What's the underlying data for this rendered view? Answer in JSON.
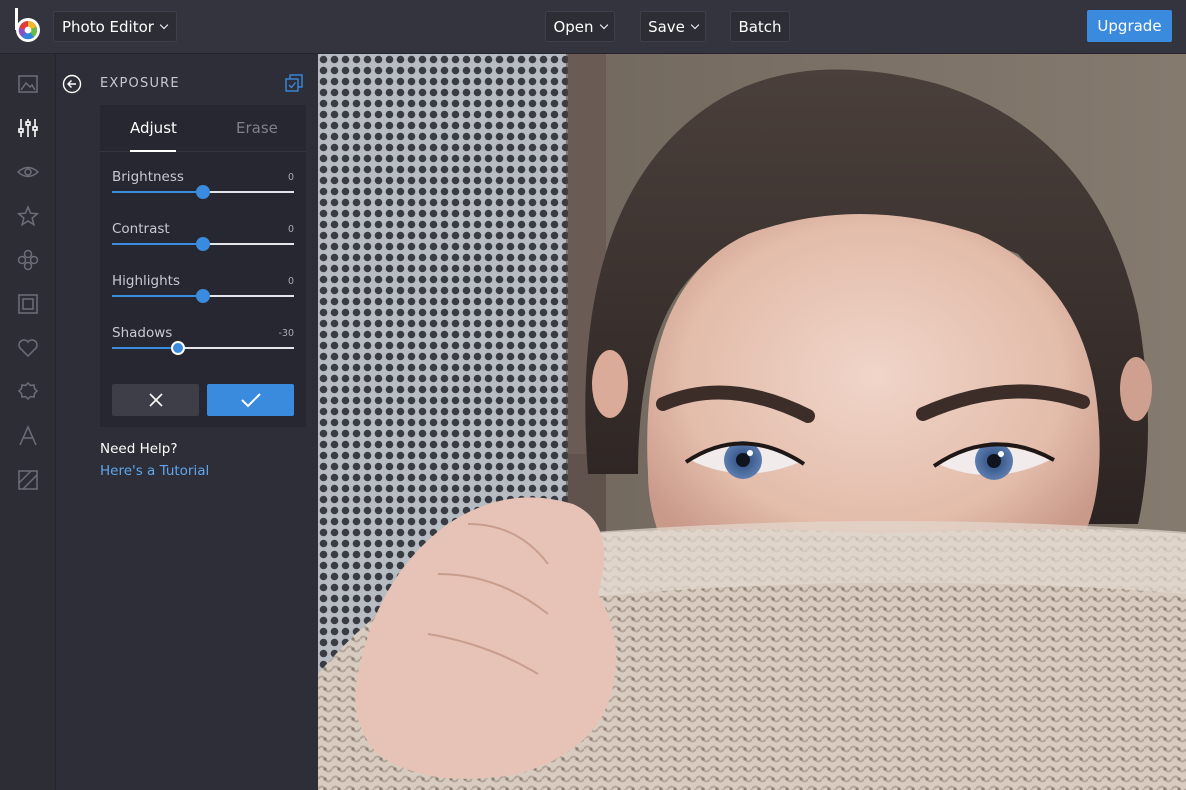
{
  "header": {
    "app_menu_label": "Photo Editor",
    "open_label": "Open",
    "save_label": "Save",
    "batch_label": "Batch",
    "upgrade_label": "Upgrade"
  },
  "rail": {
    "icons": [
      "image-icon",
      "sliders-icon",
      "eye-icon",
      "star-icon",
      "clover-icon",
      "frame-icon",
      "heart-icon",
      "badge-icon",
      "text-icon",
      "texture-icon"
    ],
    "active": "sliders-icon"
  },
  "panel": {
    "title": "EXPOSURE",
    "tabs": [
      {
        "label": "Adjust",
        "active": true
      },
      {
        "label": "Erase",
        "active": false
      }
    ],
    "sliders": [
      {
        "label": "Brightness",
        "value": "0",
        "position": 0.5
      },
      {
        "label": "Contrast",
        "value": "0",
        "position": 0.5
      },
      {
        "label": "Highlights",
        "value": "0",
        "position": 0.5
      },
      {
        "label": "Shadows",
        "value": "-30",
        "position": 0.36
      }
    ],
    "help_title": "Need Help?",
    "help_link": "Here's a Tutorial"
  },
  "colors": {
    "accent": "#3a8ade",
    "topbar": "#33343d",
    "panel": "#2d2e37",
    "card": "#262730"
  }
}
